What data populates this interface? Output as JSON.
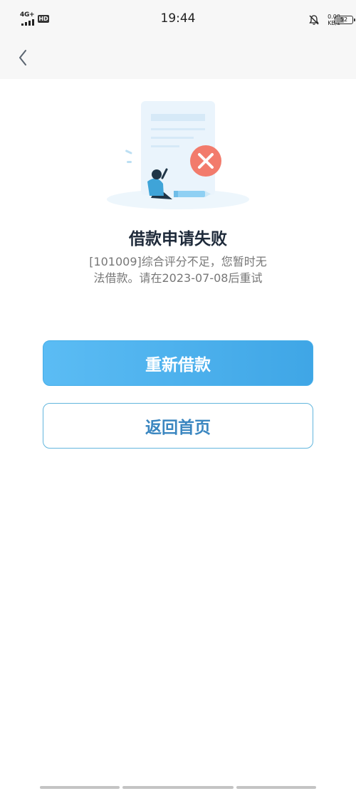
{
  "status_bar": {
    "network": "4G+",
    "hd_badge": "HD",
    "time": "19:44",
    "speed_value": "0.00",
    "speed_unit": "KB/s",
    "battery": "52",
    "battery_level": 0.52
  },
  "nav": {
    "back_icon": "chevron-left-icon"
  },
  "result": {
    "illustration_icon": "error-x-icon",
    "title": "借款申请失败",
    "message": "[101009]综合评分不足，您暂时无法借款。请在2023-07-08后重试"
  },
  "actions": {
    "retry_label": "重新借款",
    "home_label": "返回首页"
  },
  "colors": {
    "primary": "#4aaeea",
    "error": "#f27b6c",
    "title": "#1e2a3a",
    "message": "#777777"
  }
}
